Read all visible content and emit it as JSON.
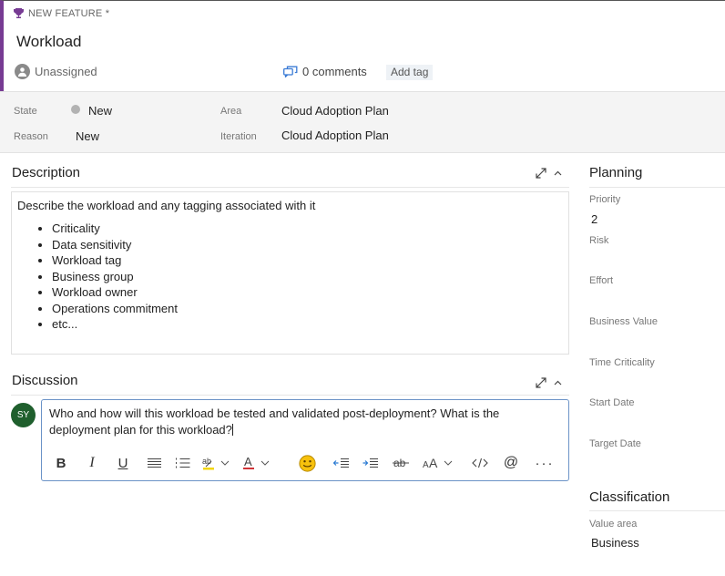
{
  "header": {
    "work_item_type": "NEW FEATURE *",
    "title": "Workload",
    "assigned_to": "Unassigned",
    "comments_label": "0 comments",
    "add_tag_label": "Add tag"
  },
  "fields": {
    "state_label": "State",
    "state_value": "New",
    "reason_label": "Reason",
    "reason_value": "New",
    "area_label": "Area",
    "area_value": "Cloud Adoption Plan",
    "iteration_label": "Iteration",
    "iteration_value": "Cloud Adoption Plan",
    "state_color": "#b2b2b2"
  },
  "description": {
    "title": "Description",
    "intro": "Describe the workload and any tagging associated with it",
    "items": [
      "Criticality",
      "Data sensitivity",
      "Workload tag",
      "Business group",
      "Workload owner",
      "Operations commitment",
      "etc..."
    ]
  },
  "discussion": {
    "title": "Discussion",
    "avatar_initials": "SY",
    "avatar_color": "#1f5f2d",
    "comment_text": "Who and how will this workload be tested and validated post-deployment? What is the deployment plan for this workload?",
    "toolbar": [
      "bold-icon",
      "italic-icon",
      "underline-icon",
      "align-icon",
      "numbered-list-icon",
      "highlight-icon",
      "font-color-icon",
      "emoji-icon",
      "outdent-icon",
      "indent-icon",
      "strikethrough-icon",
      "font-size-icon",
      "code-icon",
      "mention-icon",
      "more-icon"
    ]
  },
  "planning": {
    "title": "Planning",
    "priority_label": "Priority",
    "priority_value": "2",
    "risk_label": "Risk",
    "effort_label": "Effort",
    "business_value_label": "Business Value",
    "time_criticality_label": "Time Criticality",
    "start_date_label": "Start Date",
    "target_date_label": "Target Date"
  },
  "classification": {
    "title": "Classification",
    "value_area_label": "Value area",
    "value_area_value": "Business"
  },
  "colors": {
    "accent": "#773b93",
    "focus_border": "#6b93c7"
  }
}
